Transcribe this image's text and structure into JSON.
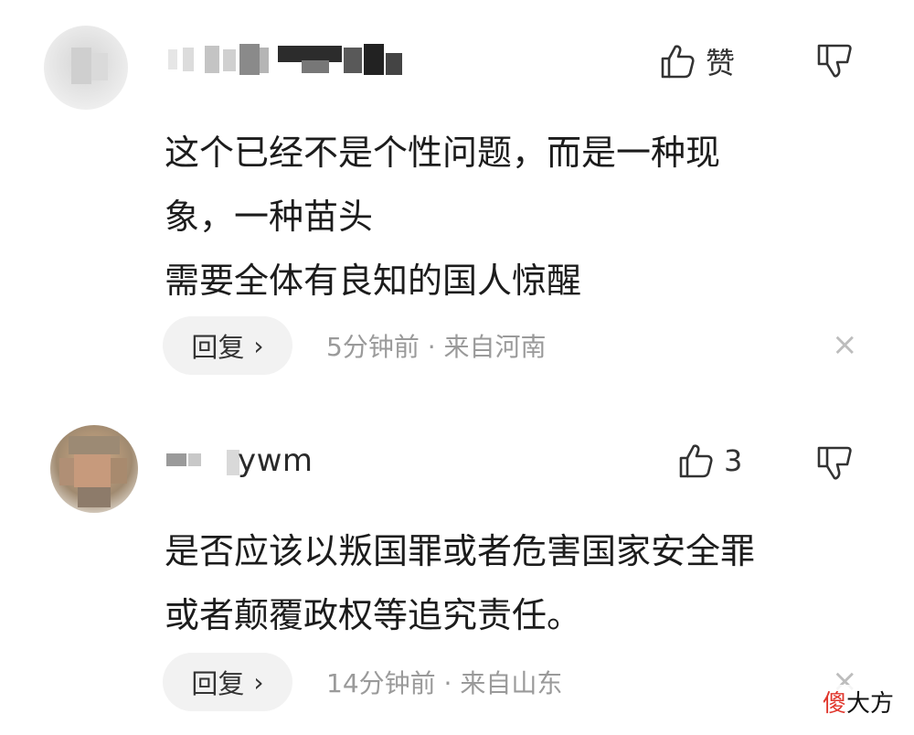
{
  "comments": [
    {
      "username": "",
      "like_label": "赞",
      "text_lines": [
        "这个已经不是个性问题，而是一种现",
        "象，一种苗头",
        "需要全体有良知的国人惊醒"
      ],
      "reply_label": "回复",
      "reply_chevron": "›",
      "meta": "5分钟前 · 来自河南",
      "close": "×"
    },
    {
      "username": "ywm",
      "like_label": "3",
      "text_lines": [
        "是否应该以叛国罪或者危害国家安全罪",
        "或者颠覆政权等追究责任。"
      ],
      "reply_label": "回复",
      "reply_chevron": "›",
      "meta": "14分钟前 · 来自山东",
      "close": "×"
    }
  ],
  "watermark": {
    "accent": "傻",
    "rest": "大方"
  },
  "icons": {
    "like": "thumbs-up-icon",
    "dislike": "thumbs-down-icon",
    "close": "close-icon"
  }
}
